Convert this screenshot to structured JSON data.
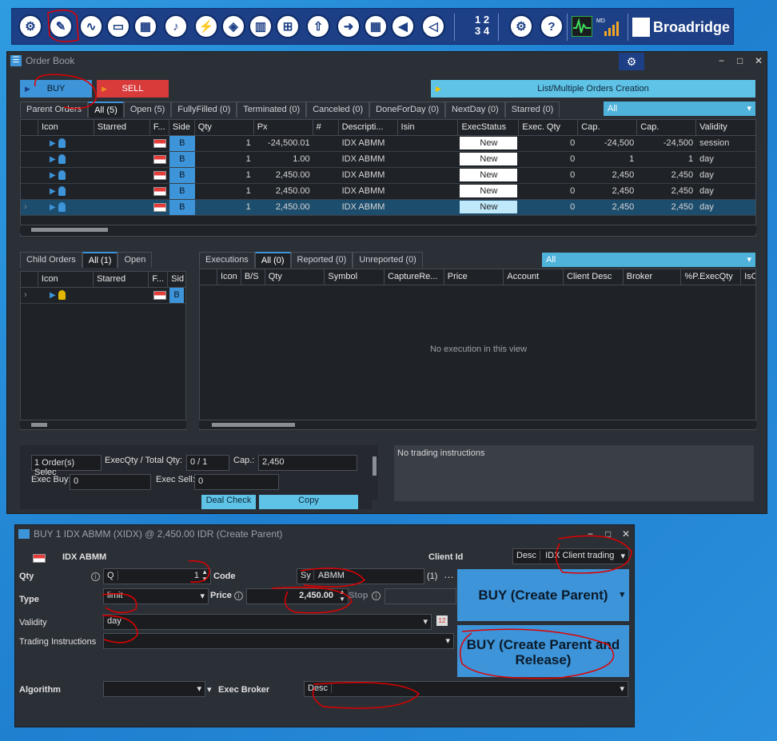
{
  "toolbar": {
    "icons": [
      "admin-icon",
      "order-book-icon",
      "market-activity-icon",
      "folder-icon",
      "calculator-icon",
      "alerts-icon",
      "connect-icon",
      "box-icon",
      "building-icon",
      "basket-icon",
      "export-icon",
      "arrow-icon",
      "grid-icon",
      "megaphone-icon",
      "broadcast-icon"
    ],
    "lot_labels": [
      "1",
      "2",
      "3",
      "4"
    ],
    "brand": "Broadridge",
    "md_label": "MD"
  },
  "order_book": {
    "title": "Order Book",
    "buy_label": "BUY",
    "sell_label": "SELL",
    "list_orders_label": "List/Multiple Orders Creation",
    "parent_tabs": {
      "label": "Parent Orders",
      "tabs": [
        "All (5)",
        "Open (5)",
        "FullyFilled (0)",
        "Terminated (0)",
        "Canceled (0)",
        "DoneForDay (0)",
        "NextDay (0)",
        "Starred (0)"
      ],
      "filter": "All"
    },
    "parent_columns": [
      "Icon",
      "Starred",
      "F...",
      "Side",
      "Qty",
      "Px",
      "#",
      "Descripti...",
      "Isin",
      "ExecStatus",
      "Exec. Qty",
      "Cap.",
      "Cap.",
      "Validity"
    ],
    "parent_rows": [
      {
        "side": "B",
        "qty": "1",
        "px": "-24,500.01",
        "desc": "IDX ABMM",
        "status": "New",
        "exec_qty": "0",
        "cap1": "-24,500",
        "cap2": "-24,500",
        "validity": "session"
      },
      {
        "side": "B",
        "qty": "1",
        "px": "1.00",
        "desc": "IDX ABMM",
        "status": "New",
        "exec_qty": "0",
        "cap1": "1",
        "cap2": "1",
        "validity": "day"
      },
      {
        "side": "B",
        "qty": "1",
        "px": "2,450.00",
        "desc": "IDX ABMM",
        "status": "New",
        "exec_qty": "0",
        "cap1": "2,450",
        "cap2": "2,450",
        "validity": "day"
      },
      {
        "side": "B",
        "qty": "1",
        "px": "2,450.00",
        "desc": "IDX ABMM",
        "status": "New",
        "exec_qty": "0",
        "cap1": "2,450",
        "cap2": "2,450",
        "validity": "day"
      },
      {
        "side": "B",
        "qty": "1",
        "px": "2,450.00",
        "desc": "IDX ABMM",
        "status": "New",
        "exec_qty": "0",
        "cap1": "2,450",
        "cap2": "2,450",
        "validity": "day"
      }
    ],
    "child_tabs": {
      "label": "Child Orders",
      "tabs": [
        "All (1)",
        "Open"
      ]
    },
    "child_columns": [
      "Icon",
      "Starred",
      "F...",
      "Sid"
    ],
    "child_rows": [
      {
        "side": "B"
      }
    ],
    "exec_tabs": {
      "label": "Executions",
      "tabs": [
        "All (0)",
        "Reported (0)",
        "Unreported (0)"
      ],
      "filter": "All"
    },
    "exec_columns": [
      "Icon",
      "B/S",
      "Qty",
      "Symbol",
      "CaptureRe...",
      "Price",
      "Account",
      "Client Desc",
      "Broker",
      "%P.ExecQty",
      "IsC"
    ],
    "exec_empty": "No execution in this view",
    "summary": {
      "selected": "1 Order(s) Selec",
      "exec_total_label": "ExecQty / Total Qty:",
      "exec_total_value": "0 / 1",
      "cap_label": "Cap.:",
      "cap_value": "2,450",
      "exec_buy_label": "Exec Buy:",
      "exec_buy_value": "0",
      "exec_sell_label": "Exec Sell:",
      "exec_sell_value": "0",
      "deal_check": "Deal Check",
      "copy": "Copy"
    },
    "instructions": "No trading instructions"
  },
  "ticket": {
    "title": "BUY 1 IDX ABMM (XIDX) @ 2,450.00 IDR (Create Parent)",
    "instrument": "IDX ABMM",
    "client_id_label": "Client Id",
    "desc_label": "Desc",
    "client_value": "IDX Client trading",
    "qty_label": "Qty",
    "q_label": "Q",
    "qty_value": "1",
    "code_label": "Code",
    "sy_label": "Sy",
    "symbol_value": "ABMM",
    "symbol_count": "(1)",
    "type_label": "Type",
    "type_value": "limit",
    "price_label": "Price",
    "price_value": "2,450.00",
    "stop_label": "Stop",
    "validity_label": "Validity",
    "validity_value": "day",
    "trading_instr_label": "Trading Instructions",
    "algorithm_label": "Algorithm",
    "exec_broker_label": "Exec Broker",
    "broker_desc_label": "Desc",
    "buy_create_parent": "BUY (Create Parent)",
    "buy_create_release": "BUY (Create Parent and Release)"
  }
}
